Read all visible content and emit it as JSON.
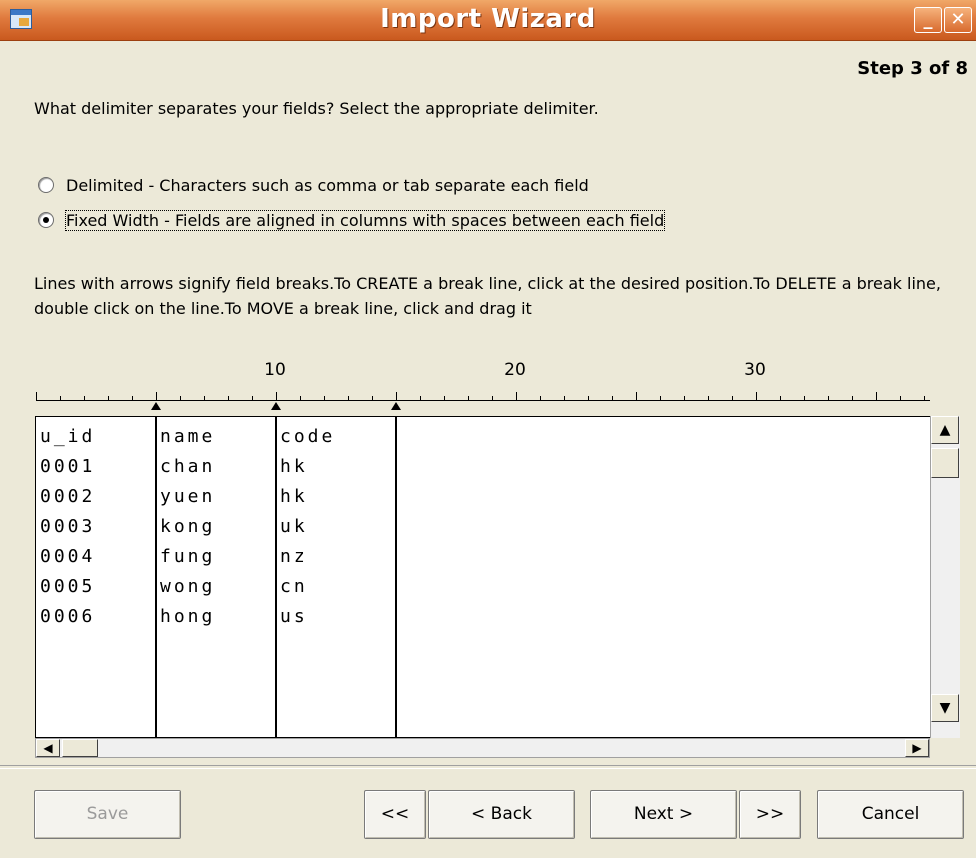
{
  "window": {
    "title": "Import Wizard",
    "minimize_glyph": "_",
    "close_glyph": "✕",
    "app_icon": "import-wizard-icon"
  },
  "step_label": "Step 3 of 8",
  "question": "What delimiter separates your fields? Select the appropriate delimiter.",
  "options": [
    {
      "label": "Delimited - Characters such as comma or tab separate each field",
      "selected": false
    },
    {
      "label": "Fixed Width - Fields are aligned in columns with spaces between each field",
      "selected": true
    }
  ],
  "instructions": "Lines with arrows signify field breaks.To CREATE a break line, click at the desired position.To DELETE a break line, double click on the line.To MOVE a break line, click and drag it",
  "ruler": {
    "labels": [
      "10",
      "20",
      "30"
    ]
  },
  "preview": {
    "columns": [
      [
        "u_id",
        "0001",
        "0002",
        "0003",
        "0004",
        "0005",
        "0006"
      ],
      [
        "name",
        "chan",
        "yuen",
        "kong",
        "fung",
        "wong",
        "hong"
      ],
      [
        "code",
        "hk",
        "hk",
        "uk",
        "nz",
        "cn",
        "us"
      ]
    ]
  },
  "scrollbars": {
    "up": "▲",
    "down": "▼",
    "left": "◀",
    "right": "▶"
  },
  "buttons": {
    "save": "Save",
    "first": "<<",
    "back": "< Back",
    "next": "Next >",
    "last": ">>",
    "cancel": "Cancel"
  },
  "colors": {
    "titlebar": "#e07a3e",
    "background": "#ece9d8"
  }
}
